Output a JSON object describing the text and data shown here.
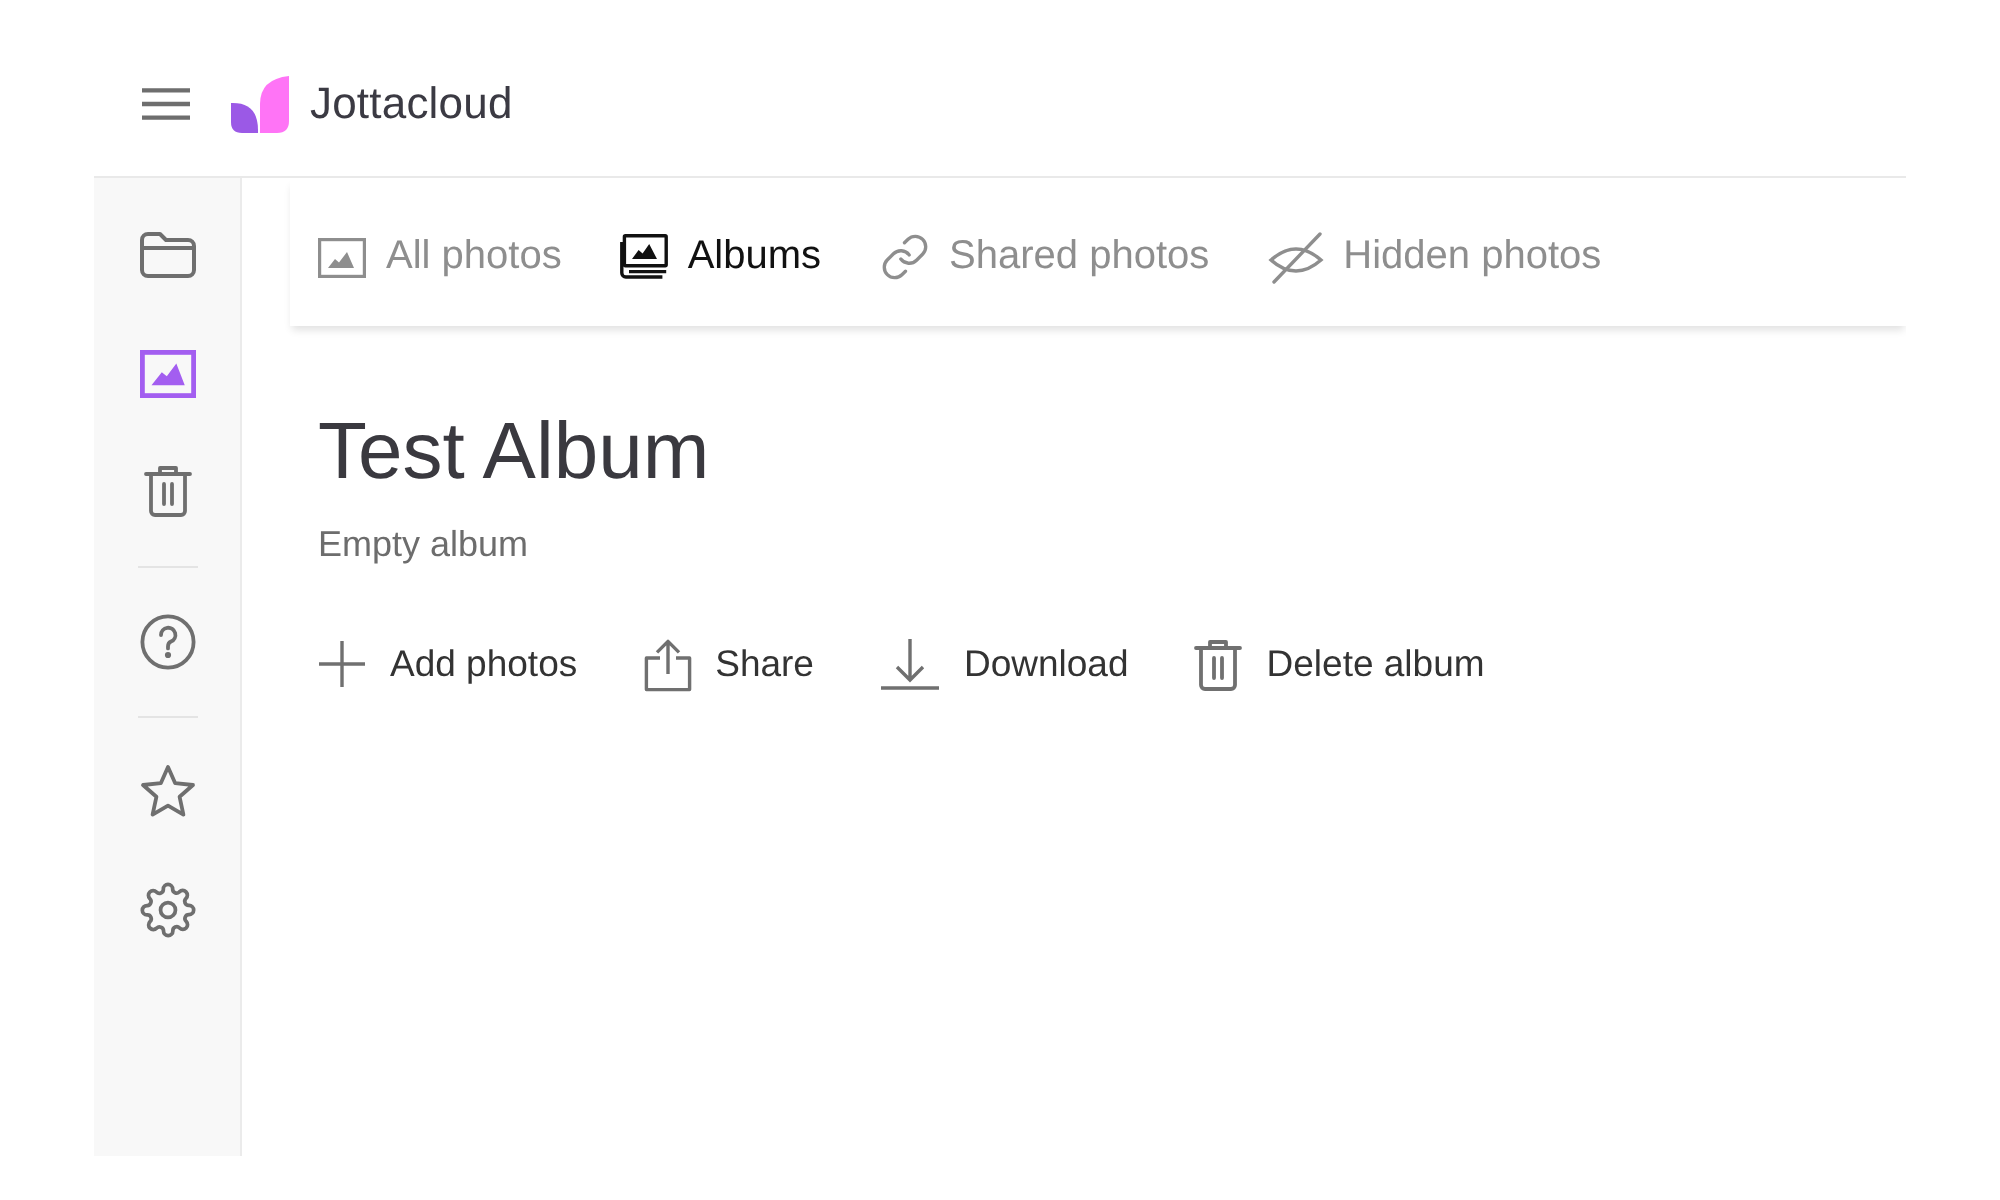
{
  "header": {
    "app_name": "Jottacloud"
  },
  "sidebar": {
    "groups": [
      {
        "items": [
          {
            "selected": false
          },
          {
            "selected": true
          },
          {
            "selected": false
          }
        ]
      },
      {
        "items": [
          {
            "selected": false
          }
        ]
      },
      {
        "items": [
          {
            "selected": false
          },
          {
            "selected": false
          }
        ]
      }
    ]
  },
  "tabs": [
    {
      "label": "All photos",
      "selected": false
    },
    {
      "label": "Albums",
      "selected": true
    },
    {
      "label": "Shared photos",
      "selected": false
    },
    {
      "label": "Hidden photos",
      "selected": false
    }
  ],
  "album": {
    "title": "Test Album",
    "subtitle": "Empty album"
  },
  "actions": [
    "Add photos",
    "Share",
    "Download",
    "Delete album"
  ]
}
